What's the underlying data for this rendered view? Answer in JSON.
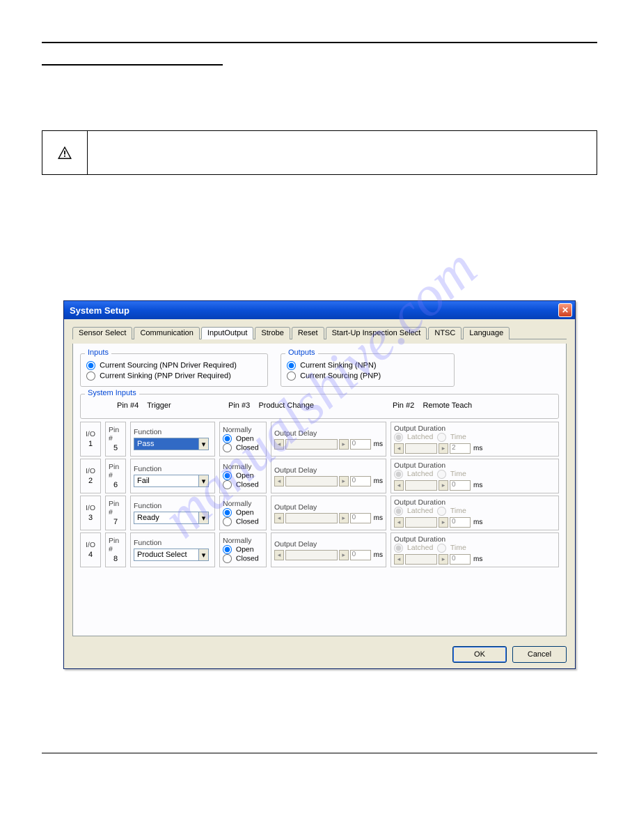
{
  "dialog": {
    "title": "System  Setup",
    "tabs": [
      "Sensor Select",
      "Communication",
      "InputOutput",
      "Strobe",
      "Reset",
      "Start-Up Inspection Select",
      "NTSC",
      "Language"
    ],
    "active_tab": "InputOutput",
    "inputs_group": {
      "title": "Inputs",
      "opt1": "Current Sourcing  (NPN Driver Required)",
      "opt2": "Current Sinking    (PNP Driver Required)",
      "selected": 1
    },
    "outputs_group": {
      "title": "Outputs",
      "opt1": "Current Sinking     (NPN)",
      "opt2": "Current Sourcing   (PNP)",
      "selected": 1
    },
    "system_inputs": {
      "title": "System Inputs",
      "pin4": {
        "label": "Pin #4",
        "text": "Trigger"
      },
      "pin3": {
        "label": "Pin #3",
        "text": "Product Change"
      },
      "pin2": {
        "label": "Pin #2",
        "text": "Remote Teach"
      }
    },
    "col_headers": {
      "io": "I/O",
      "pin": "Pin #",
      "function": "Function",
      "normally": "Normally",
      "open": "Open",
      "closed": "Closed",
      "output_delay": "Output Delay",
      "output_duration": "Output Duration",
      "latched": "Latched",
      "time": "Time",
      "ms": "ms"
    },
    "rows": [
      {
        "io": "1",
        "pin": "5",
        "function": "Pass",
        "selected": true,
        "normally": "open",
        "delay": "0",
        "dur": "2",
        "dur_mode": "latched"
      },
      {
        "io": "2",
        "pin": "6",
        "function": "Fail",
        "selected": false,
        "normally": "open",
        "delay": "0",
        "dur": "0",
        "dur_mode": "latched"
      },
      {
        "io": "3",
        "pin": "7",
        "function": "Ready",
        "selected": false,
        "normally": "open",
        "delay": "0",
        "dur": "0",
        "dur_mode": "latched"
      },
      {
        "io": "4",
        "pin": "8",
        "function": "Product Select",
        "selected": false,
        "normally": "open",
        "delay": "0",
        "dur": "0",
        "dur_mode": "latched"
      }
    ],
    "buttons": {
      "ok": "OK",
      "cancel": "Cancel"
    }
  },
  "watermark": "manualshive.com"
}
